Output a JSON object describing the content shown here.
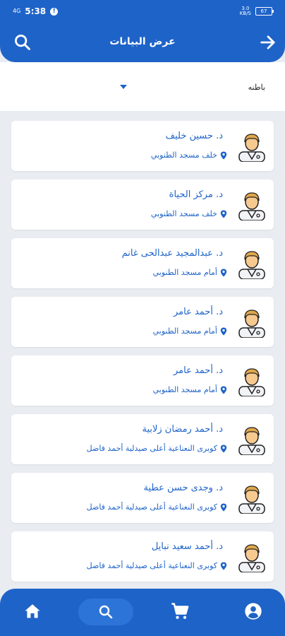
{
  "status_bar": {
    "signal": "4G",
    "time": "5:38",
    "net_speed": "3.0\nKB/S",
    "battery": "67"
  },
  "app_bar": {
    "title": "عرض البيانات"
  },
  "filter": {
    "selected": "باطنه"
  },
  "doctors": [
    {
      "name": "د. حسين خليف",
      "address": "خلف مسجد الطنوبي"
    },
    {
      "name": "د. مركز الحياة",
      "address": "خلف مسجد الطنوبي"
    },
    {
      "name": "د. عبدالمجيد عبدالحى غانم",
      "address": "أمام مسجد الطنوبي"
    },
    {
      "name": "د. أحمد عامر",
      "address": "أمام مسجد الطنوبي"
    },
    {
      "name": "د. أحمد عامر",
      "address": "أمام مسجد الطنوبي"
    },
    {
      "name": "د. أحمد رمضان زلابية",
      "address": "كوبرى النعناعية أعلى صيدلية أحمد فاضل"
    },
    {
      "name": "د. وجدى حسن عطية",
      "address": "كوبرى النعناعية أعلى صيدلية أحمد فاضل"
    },
    {
      "name": "د. أحمد سعيد نبايل",
      "address": "كوبرى النعناعية أعلى صيدلية أحمد فاضل"
    }
  ],
  "colors": {
    "primary": "#1e63c8",
    "background": "#e9ecf1"
  },
  "icons": {
    "search": "search-icon",
    "forward": "arrow-forward-icon",
    "home": "home-icon",
    "cart": "cart-icon",
    "account": "account-icon",
    "pin": "location-pin-icon",
    "avatar": "doctor-avatar-icon"
  }
}
